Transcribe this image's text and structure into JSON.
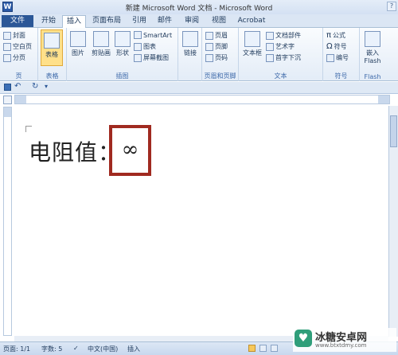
{
  "window": {
    "title": "新建 Microsoft Word 文档 - Microsoft Word",
    "app_icon": "W"
  },
  "tabs": [
    {
      "label": "文件"
    },
    {
      "label": "开始"
    },
    {
      "label": "插入"
    },
    {
      "label": "页面布局"
    },
    {
      "label": "引用"
    },
    {
      "label": "邮件"
    },
    {
      "label": "审阅"
    },
    {
      "label": "视图"
    },
    {
      "label": "Acrobat"
    }
  ],
  "ribbon": {
    "pages": {
      "items": [
        "封面",
        "空白页",
        "分页"
      ],
      "label": "页"
    },
    "tables": {
      "button": "表格",
      "label": "表格"
    },
    "illustrations": {
      "picture": "图片",
      "clipart": "剪贴画",
      "shapes": "形状",
      "smartart": "SmartArt",
      "chart": "图表",
      "screenshot": "屏幕截图",
      "label": "插图"
    },
    "links": {
      "button": "链接"
    },
    "header_footer": {
      "items": [
        "页眉",
        "页脚",
        "页码"
      ],
      "label": "页眉和页脚"
    },
    "text": {
      "textbox": "文本框",
      "items": [
        "文档部件",
        "艺术字",
        "首字下沉"
      ],
      "label": "文本"
    },
    "symbols": {
      "items": [
        "公式",
        "符号",
        "编号"
      ],
      "label": "符号"
    },
    "flash": {
      "button": "嵌入 Flash",
      "label": "Flash"
    }
  },
  "document": {
    "text": "电阻值：",
    "symbol": "∞"
  },
  "statusbar": {
    "page": "页面: 1/1",
    "words": "字数: 5",
    "language": "中文(中国)",
    "mode": "插入"
  },
  "watermark": {
    "logo": "♥",
    "title": "冰糖安卓网",
    "url": "www.btxtdmy.com"
  }
}
